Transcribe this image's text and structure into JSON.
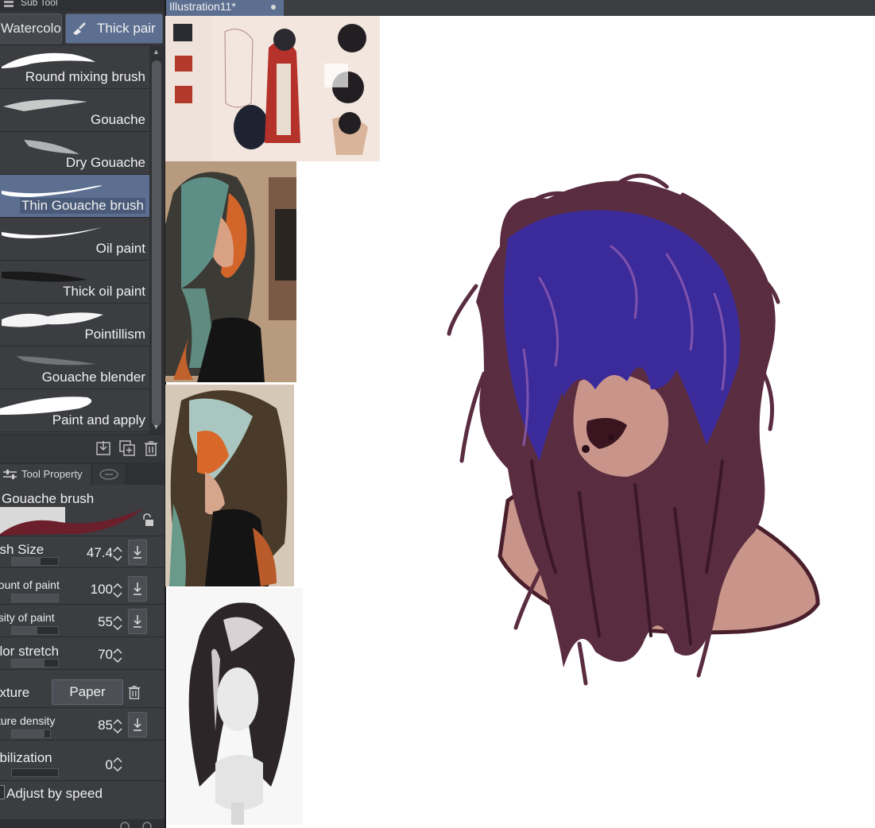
{
  "sub_tool": {
    "header": "Sub Tool",
    "tabs": [
      "Watercolo",
      "Thick pair"
    ],
    "brushes": [
      "Round mixing brush",
      "Gouache",
      "Dry Gouache",
      "Thin Gouache brush",
      "Oil paint",
      "Thick oil paint",
      "Pointillism",
      "Gouache blender",
      "Paint and apply"
    ],
    "selected_index": 3
  },
  "tool_property": {
    "header": "Tool Property",
    "brush_name": "Gouache brush",
    "properties": [
      {
        "label": "ush Size",
        "value": "47.4",
        "fill": 0.62
      },
      {
        "label": "nount of paint",
        "value": "100",
        "fill": 1.0
      },
      {
        "label": "nsity of paint",
        "value": "55",
        "fill": 0.55
      },
      {
        "label": "olor stretch",
        "value": "70",
        "fill": 0.7
      },
      {
        "label": "exture",
        "value": "Paper"
      },
      {
        "label": "xture density",
        "value": "85",
        "fill": 0.85
      },
      {
        "label": "abilization",
        "value": "0",
        "fill": 0.0
      }
    ],
    "adjust_by_speed": "Adjust by speed"
  },
  "document": {
    "tab_title": "Illustration11*"
  },
  "colors": {
    "accent": "#5c6f91",
    "panel": "#3b3d41",
    "hair": "#5a2c40",
    "hair_blue": "#3b2a9a",
    "skin": "#c9958a"
  }
}
